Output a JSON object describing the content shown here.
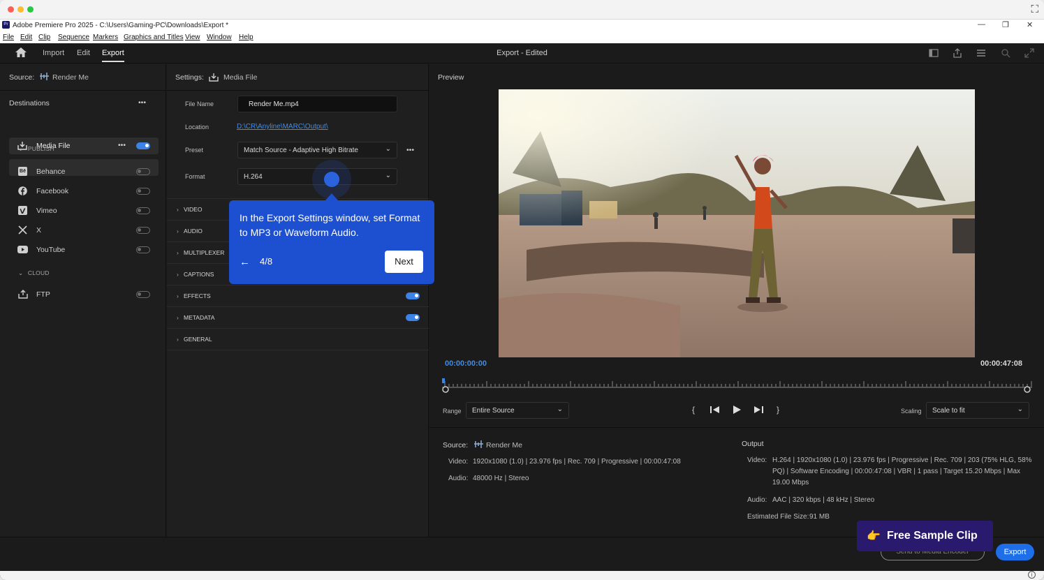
{
  "window": {
    "title": "Adobe Premiere Pro 2025 - C:\\Users\\Gaming-PC\\Downloads\\Export *",
    "app_badge": "Pr",
    "controls": [
      "—",
      "❐",
      "✕"
    ]
  },
  "menu": [
    "File",
    "Edit",
    "Clip",
    "Sequence",
    "Markers",
    "Graphics and Titles",
    "View",
    "Window",
    "Help"
  ],
  "topnav": {
    "tabs": [
      "Import",
      "Edit",
      "Export"
    ],
    "active_tab": "Export",
    "center_title": "Export - Edited"
  },
  "left": {
    "source_label": "Source:",
    "source_value": "Render Me",
    "destinations_label": "Destinations",
    "more": "•••",
    "media_file": "Media File",
    "publish_label": "PUBLISH",
    "publish_items": [
      "Behance",
      "Facebook",
      "Vimeo",
      "X",
      "YouTube"
    ],
    "cloud_label": "CLOUD",
    "cloud_items": [
      "FTP"
    ],
    "badge_behance": "Bē"
  },
  "settings": {
    "label": "Settings:",
    "value": "Media File",
    "file_name_label": "File Name",
    "file_name": "Render Me.mp4",
    "location_label": "Location",
    "location": "D:\\CR\\Anyline\\MARC\\Output\\",
    "preset_label": "Preset",
    "preset": "Match Source - Adaptive High Bitrate",
    "format_label": "Format",
    "format": "H.264",
    "sections": [
      "VIDEO",
      "AUDIO",
      "MULTIPLEXER",
      "CAPTIONS",
      "EFFECTS",
      "METADATA",
      "GENERAL"
    ]
  },
  "tooltip": {
    "text": "In the Export Settings window, set Format to MP3 or Waveform Audio.",
    "step": "4/8",
    "next": "Next",
    "back_arrow": "←"
  },
  "preview": {
    "label": "Preview",
    "timecode_start": "00:00:00:00",
    "timecode_end": "00:00:47:08",
    "range_label": "Range",
    "range_value": "Entire Source",
    "scaling_label": "Scaling",
    "scaling_value": "Scale to fit"
  },
  "source_info": {
    "label": "Source:",
    "name": "Render Me",
    "video_label": "Video:",
    "video": "1920x1080 (1.0)  |  23.976 fps  |  Rec. 709  |  Progressive  |  00:00:47:08",
    "audio_label": "Audio:",
    "audio": "48000 Hz  |  Stereo"
  },
  "output_info": {
    "label": "Output",
    "video_label": "Video:",
    "video_line1": "H.264  |  1920x1080 (1.0)  |  23.976 fps  |  Progressive  |  Rec. 709  |  203 (75% HLG, 58%",
    "video_line2": "PQ)  |  Software Encoding  |  00:00:47:08   |  VBR  |  1 pass  |  Target 15.20 Mbps  |  Max",
    "video_line3": "19.00 Mbps",
    "audio_label": "Audio:",
    "audio": "AAC  |  320 kbps  |  48 kHz  |  Stereo",
    "size_label": "Estimated File Size:",
    "size": "91 MB"
  },
  "bottom": {
    "send_to_encoder": "Send to Media Encoder",
    "export": "Export",
    "free_clip": "Free Sample Clip",
    "free_clip_emoji": "👉"
  },
  "colors": {
    "accent": "#1e6ee9",
    "tooltip_bg": "#1d4fd1",
    "timecode": "#3b8eed",
    "free_clip_bg": "#2a1a6e"
  }
}
